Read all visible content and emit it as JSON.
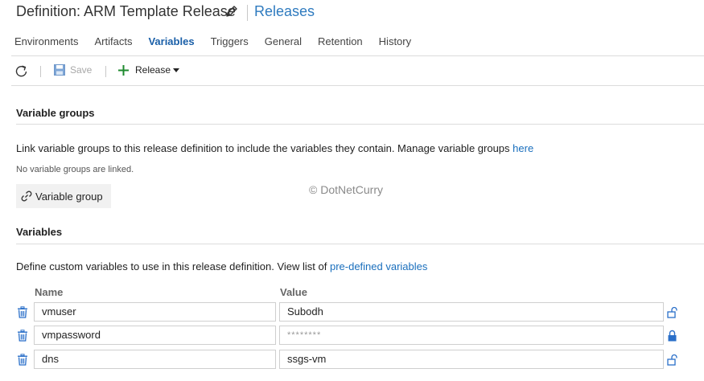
{
  "header": {
    "title": "Definition: ARM Template Release",
    "releases_link": "Releases"
  },
  "tabs": [
    {
      "label": "Environments"
    },
    {
      "label": "Artifacts"
    },
    {
      "label": "Variables",
      "active": true
    },
    {
      "label": "Triggers"
    },
    {
      "label": "General"
    },
    {
      "label": "Retention"
    },
    {
      "label": "History"
    }
  ],
  "toolbar": {
    "save_label": "Save",
    "release_label": "Release"
  },
  "variable_groups": {
    "heading": "Variable groups",
    "description": "Link variable groups to this release definition to include the variables they contain. Manage variable groups ",
    "description_link": "here",
    "empty_note": "No variable groups are linked.",
    "add_button_label": "Variable group"
  },
  "watermark": "© DotNetCurry",
  "variables": {
    "heading": "Variables",
    "description": "Define custom variables to use in this release definition. View list of ",
    "description_link": "pre-defined variables",
    "columns": {
      "name": "Name",
      "value": "Value"
    },
    "rows": [
      {
        "name": "vmuser",
        "value": "Subodh",
        "secret": false
      },
      {
        "name": "vmpassword",
        "value": "********",
        "secret": true
      },
      {
        "name": "dns",
        "value": "ssgs-vm",
        "secret": false
      }
    ]
  },
  "colors": {
    "accent": "#1a5fa8",
    "link": "#1a6fbd",
    "add_icon": "#1e8a2e",
    "lock_icon": "#2a6fc9"
  }
}
